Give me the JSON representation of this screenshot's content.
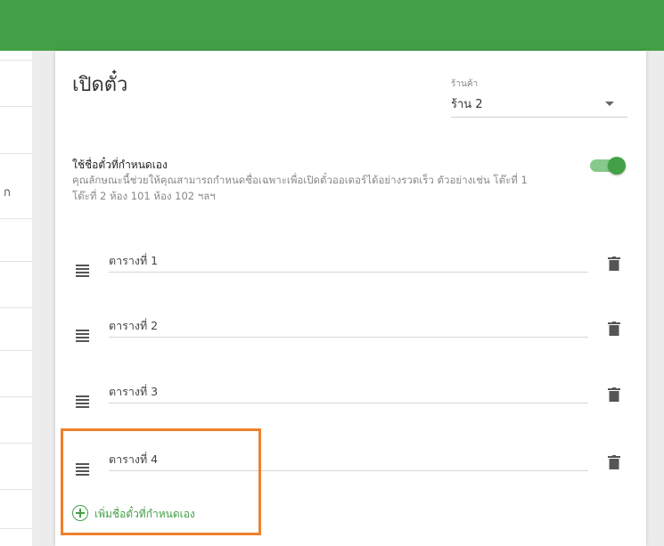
{
  "colors": {
    "brand_green": "#43a047",
    "highlight_orange": "#f0802b"
  },
  "left_panel": {
    "truncated_text": "ก"
  },
  "page": {
    "title": "เปิดตั๋ว"
  },
  "store_select": {
    "label": "ร้านค้า",
    "value": "ร้าน 2"
  },
  "custom_names": {
    "title": "ใช้ชื่อตั๋วที่กำหนดเอง",
    "description": "คุณลักษณะนี้ช่วยให้คุณสามารถกำหนดชื่อเฉพาะเพื่อเปิดตั๋วออเดอร์ได้อย่างรวดเร็ว ตัวอย่างเช่น โต๊ะที่ 1 โต๊ะที่ 2 ห้อง 101 ห้อง 102 ฯลฯ",
    "toggle_on": true
  },
  "tables": [
    {
      "label": "ตารางที่ 1"
    },
    {
      "label": "ตารางที่ 2"
    },
    {
      "label": "ตารางที่ 3"
    },
    {
      "label": "ตารางที่ 4"
    }
  ],
  "add_button": {
    "label": "เพิ่มชื่อตั๋วที่กำหนดเอง"
  }
}
